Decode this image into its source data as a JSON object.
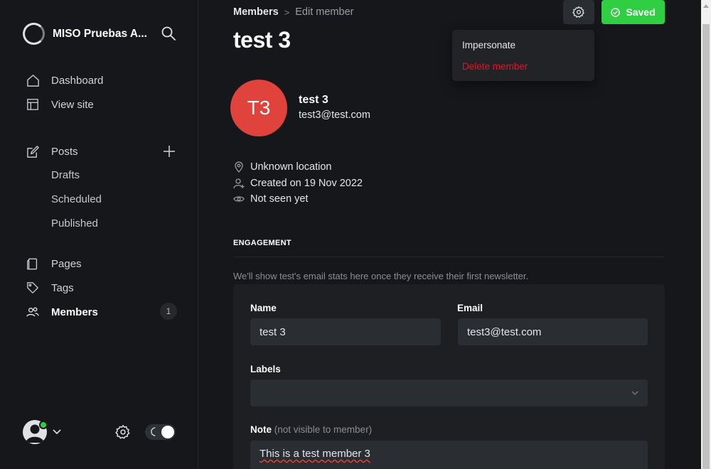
{
  "sidebar": {
    "site_name": "MISO Pruebas A...",
    "nav": {
      "dashboard": "Dashboard",
      "view_site": "View site",
      "posts": "Posts",
      "drafts": "Drafts",
      "scheduled": "Scheduled",
      "published": "Published",
      "pages": "Pages",
      "tags": "Tags",
      "members": "Members",
      "members_count": "1"
    },
    "icons": [
      "search-icon",
      "home-icon",
      "layout-icon",
      "edit-icon",
      "plus-icon",
      "page-icon",
      "tag-icon",
      "users-icon",
      "gear-icon",
      "moon-icon",
      "chevron-down-icon"
    ]
  },
  "header": {
    "breadcrumb_parent": "Members",
    "breadcrumb_sep": ">",
    "breadcrumb_current": "Edit member",
    "title": "test 3",
    "saved_label": "Saved"
  },
  "dropdown": {
    "impersonate": "Impersonate",
    "delete": "Delete member"
  },
  "member": {
    "initials": "T3",
    "name": "test 3",
    "email": "test3@test.com",
    "location": "Unknown location",
    "created": "Created on 19 Nov 2022",
    "seen": "Not seen yet"
  },
  "engagement": {
    "title": "ENGAGEMENT",
    "note": "We'll show test's email stats here once they receive their first newsletter."
  },
  "form": {
    "name_label": "Name",
    "name_value": "test 3",
    "email_label": "Email",
    "email_value": "test3@test.com",
    "labels_label": "Labels",
    "note_label": "Note",
    "note_hint": "(not visible to member)",
    "note_value": "This is a test member 3"
  },
  "colors": {
    "background": "#15171a",
    "accent_green": "#30cf43",
    "danger_red": "#f50b23",
    "avatar_red": "#e0433b"
  }
}
